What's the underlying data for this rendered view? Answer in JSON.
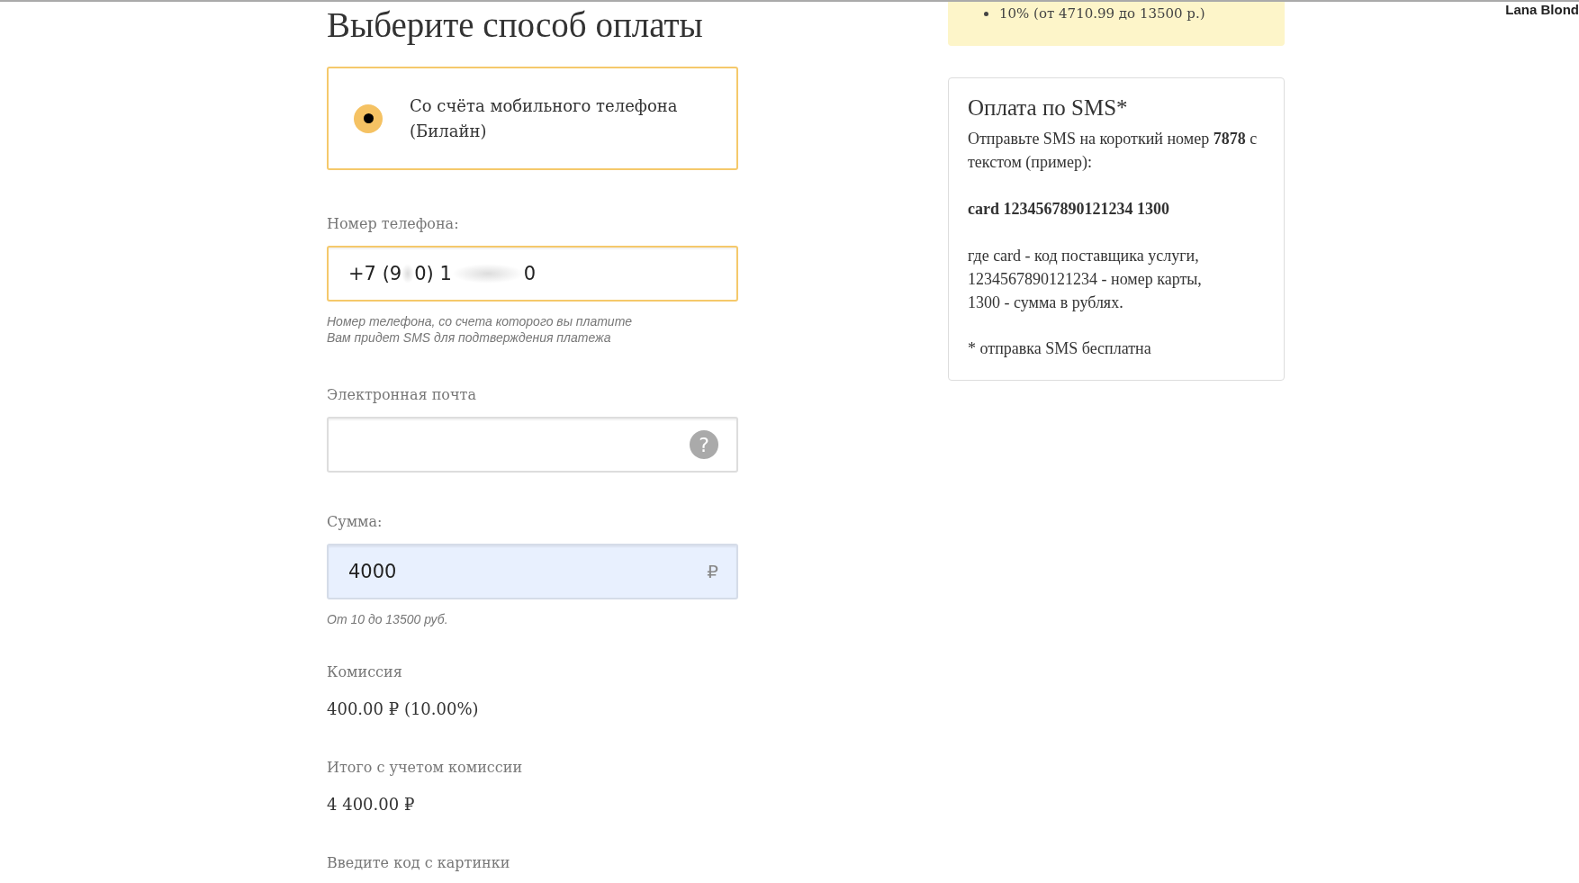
{
  "title": "Выберите способ оплаты",
  "payment_options": [
    {
      "label": "Со счёта мобильного телефона (Билайн)",
      "selected": true
    }
  ],
  "phone": {
    "label": "Номер телефона:",
    "value_parts": [
      "+7 (9",
      "0",
      ") 1",
      "0"
    ],
    "focused": true,
    "hint_lines": [
      "Номер телефона, со счета которого вы платите",
      "Вам придет SMS для подтверждения платежа"
    ]
  },
  "email": {
    "label": "Электронная почта",
    "help": "?"
  },
  "amount": {
    "label": "Сумма:",
    "value": "4000",
    "currency": "₽",
    "hint": "От 10 до 13500 руб."
  },
  "commission": {
    "label": "Комиссия",
    "value": "400.00 ₽ (10.00%)"
  },
  "total": {
    "label": "Итого с учетом комиссии",
    "value": "4 400.00 ₽"
  },
  "captcha": {
    "label": "Введите код с картинки"
  },
  "note": {
    "items": [
      "10% (от 4710.99 до 13500 р.)"
    ]
  },
  "sms_box": {
    "title": "Оплата по SMS*",
    "intro": "Отправьте SMS на короткий номер **7878** с текстом (пример):",
    "example": "card 1234567890121234 1300",
    "explanation_lines": [
      "где card - код поставщика услуги,",
      "1234567890121234 - номер карты,",
      "1300 - сумма в рублях."
    ],
    "footnote": "* отправка SMS бесплатна"
  },
  "user": "Lana Blond"
}
